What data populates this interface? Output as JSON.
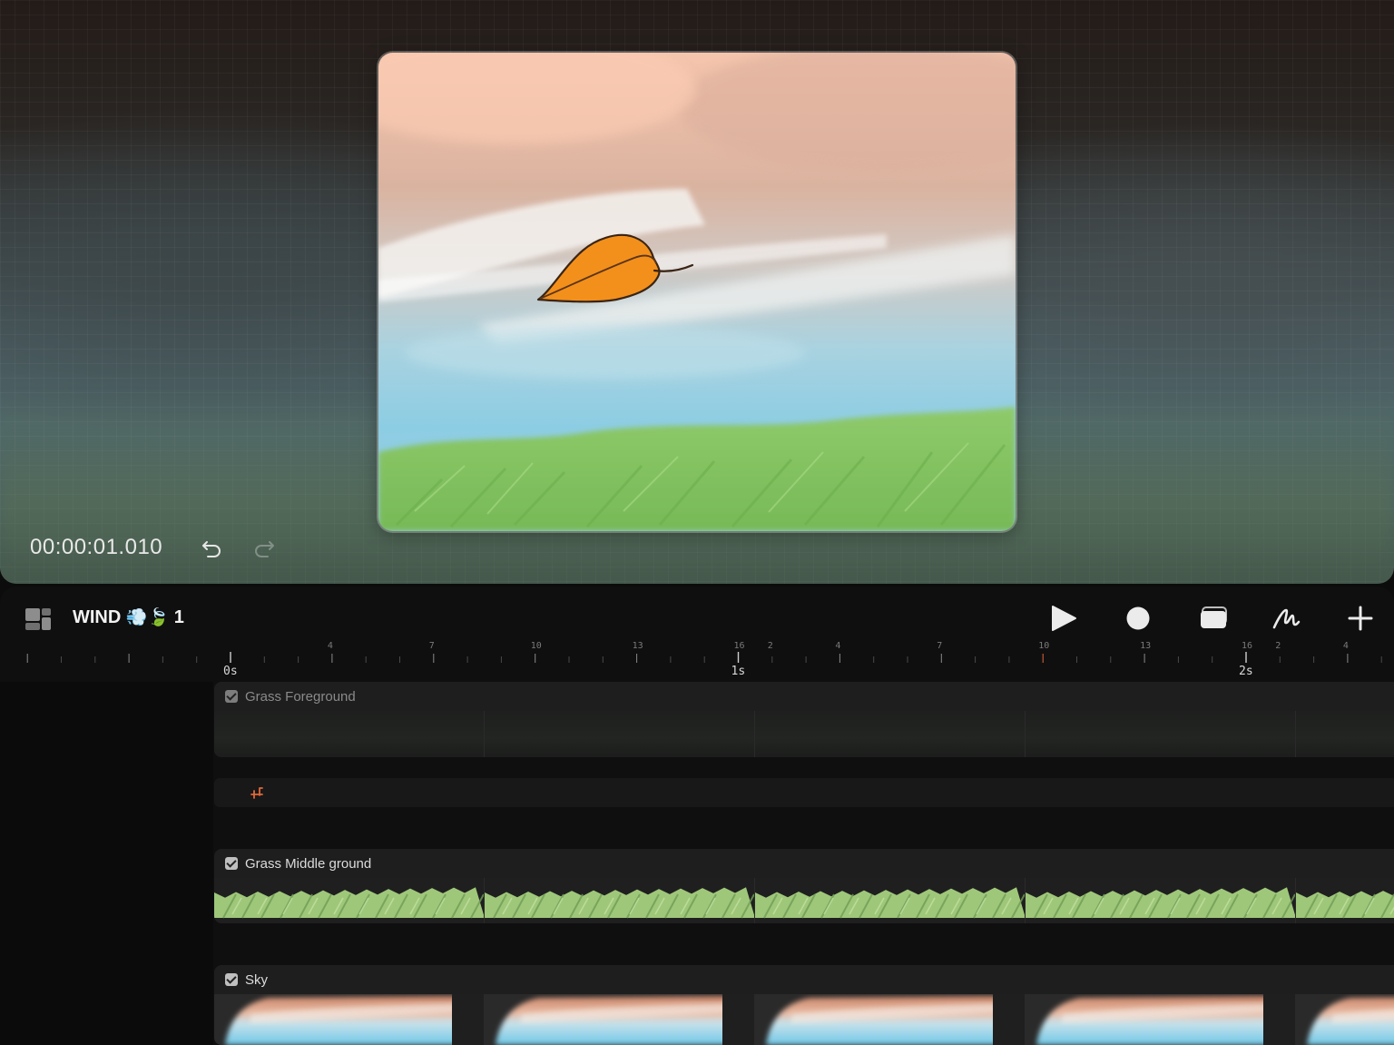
{
  "stage": {
    "timecode": "00:00:01.010",
    "undo_icon": "undo-icon",
    "redo_icon": "redo-icon"
  },
  "timeline": {
    "project_icon": "layout-grid-icon",
    "project_name": "WIND",
    "project_emoji": "💨🍃",
    "project_number": "1",
    "tools": [
      {
        "name": "play-icon"
      },
      {
        "name": "record-icon"
      },
      {
        "name": "onion-skin-icon"
      },
      {
        "name": "draw-icon"
      },
      {
        "name": "plus-icon"
      }
    ],
    "ruler": {
      "seconds": [
        "0s",
        "1s",
        "2s"
      ],
      "frame_labels": [
        "4",
        "7",
        "10",
        "13",
        "16",
        "2",
        "4",
        "7",
        "10",
        "13",
        "16",
        "2",
        "4"
      ]
    },
    "tracks": [
      {
        "name": "Grass Foreground",
        "enabled": true,
        "visible": false
      },
      {
        "name": "Grass Middle ground",
        "enabled": true,
        "visible": true
      },
      {
        "name": "Sky",
        "enabled": true,
        "visible": true
      }
    ],
    "transform_icon": "transform-keyframe-icon",
    "accent_color": "#e0683a"
  }
}
